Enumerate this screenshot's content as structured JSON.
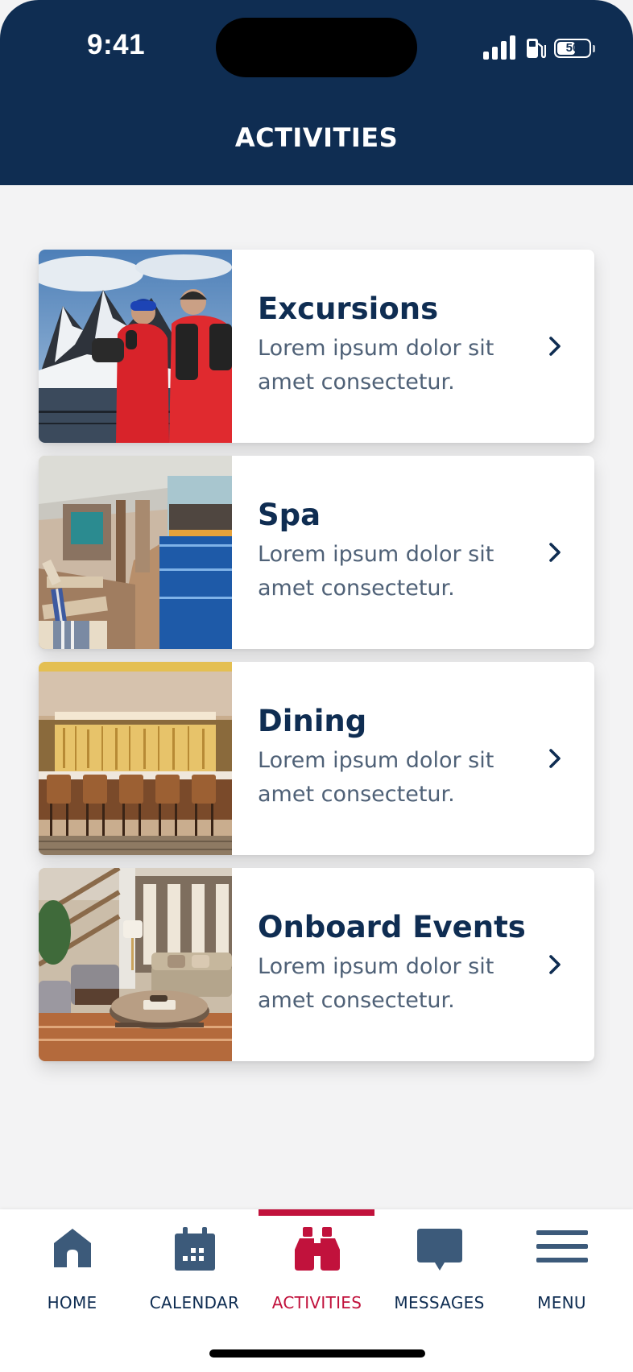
{
  "status_bar": {
    "time": "9:41",
    "battery": "50"
  },
  "header": {
    "title": "ACTIVITIES"
  },
  "cards": [
    {
      "title": "Excursions",
      "description": "Lorem ipsum dolor sit amet consectetur."
    },
    {
      "title": "Spa",
      "description": "Lorem ipsum dolor sit amet consectetur."
    },
    {
      "title": "Dining",
      "description": "Lorem ipsum dolor sit amet consectetur."
    },
    {
      "title": "Onboard Events",
      "description": "Lorem ipsum dolor sit amet consectetur."
    }
  ],
  "tabs": [
    {
      "label": "HOME",
      "icon": "home-icon"
    },
    {
      "label": "CALENDAR",
      "icon": "calendar-icon"
    },
    {
      "label": "ACTIVITIES",
      "icon": "binoculars-icon",
      "active": true
    },
    {
      "label": "MESSAGES",
      "icon": "message-bubble-icon"
    },
    {
      "label": "MENU",
      "icon": "hamburger-menu-icon"
    }
  ],
  "colors": {
    "navy": "#0f2d52",
    "accent_red": "#c1123c",
    "text_muted": "#4f6177",
    "icon_slate": "#3c5a7a",
    "background": "#f3f3f4"
  }
}
